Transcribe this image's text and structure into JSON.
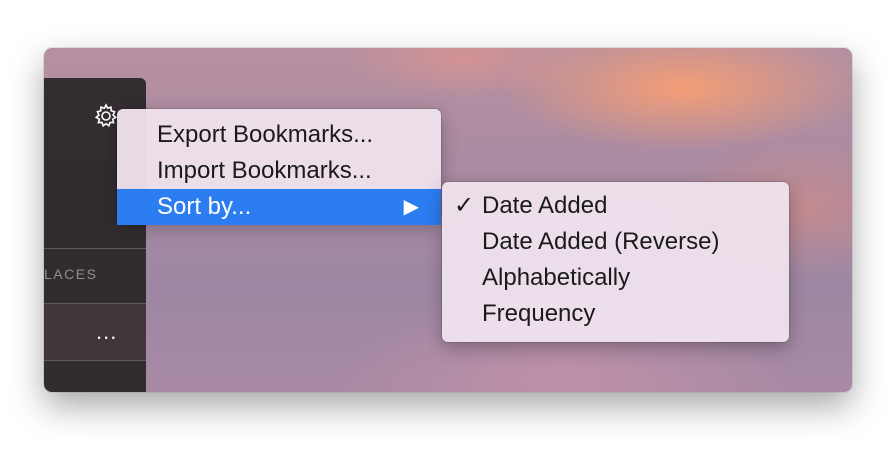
{
  "sidebar": {
    "gear_icon": "gear-icon",
    "section_label": "LACES",
    "more_label": "..."
  },
  "context_menu": {
    "items": [
      {
        "label": "Export Bookmarks..."
      },
      {
        "label": "Import Bookmarks..."
      },
      {
        "label": "Sort by...",
        "submenu_arrow": "▶",
        "highlighted": true
      }
    ],
    "highlight_color": "#2c7df2"
  },
  "sort_submenu": {
    "checkmark": "✓",
    "items": [
      {
        "label": "Date Added",
        "checked": true
      },
      {
        "label": "Date Added (Reverse)",
        "checked": false
      },
      {
        "label": "Alphabetically",
        "checked": false
      },
      {
        "label": "Frequency",
        "checked": false
      }
    ]
  }
}
